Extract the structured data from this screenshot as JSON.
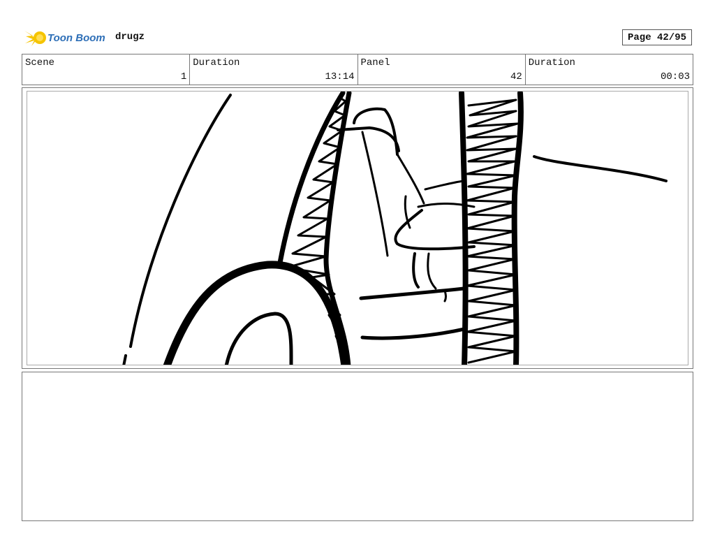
{
  "header": {
    "logo_text": "Toon Boom",
    "project_name": "drugz",
    "page_indicator": "Page 42/95"
  },
  "info": {
    "scene_label": "Scene",
    "scene_value": "1",
    "scene_duration_label": "Duration",
    "scene_duration_value": "13:14",
    "panel_label": "Panel",
    "panel_value": "42",
    "panel_duration_label": "Duration",
    "panel_duration_value": "00:03"
  },
  "colors": {
    "logo_yellow": "#f5c400",
    "logo_blue": "#2e6fb7",
    "ink": "#000000"
  }
}
